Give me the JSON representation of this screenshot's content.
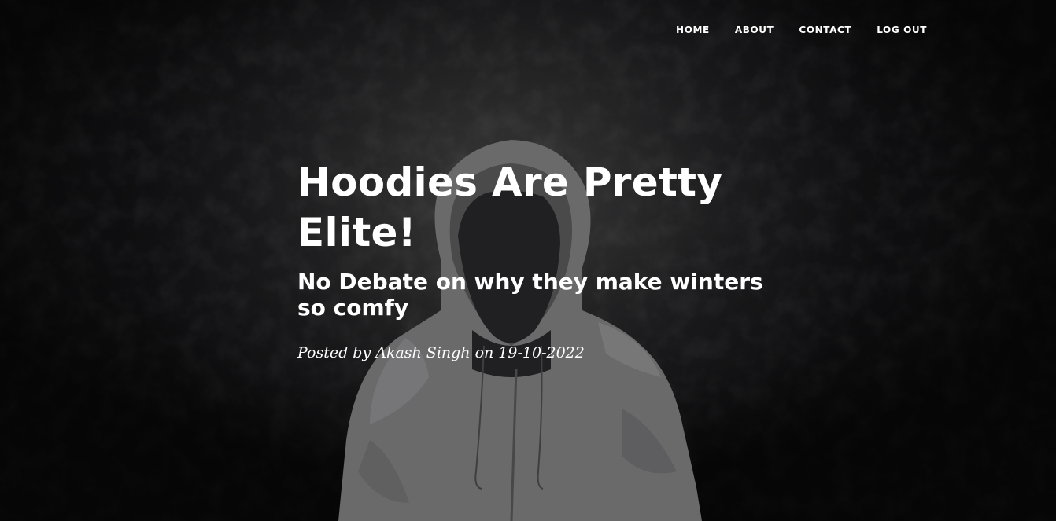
{
  "nav": {
    "items": [
      {
        "label": "HOME"
      },
      {
        "label": "ABOUT"
      },
      {
        "label": "CONTACT"
      },
      {
        "label": "LOG OUT"
      }
    ]
  },
  "post": {
    "title": "Hoodies Are Pretty Elite!",
    "subtitle": "No Debate on why they make winters so comfy",
    "meta": "Posted by Akash Singh on 19-10-2022"
  },
  "colors": {
    "background": "#141416",
    "text": "#ffffff",
    "hoodie": "#6b6b6b",
    "face": "#202022"
  }
}
